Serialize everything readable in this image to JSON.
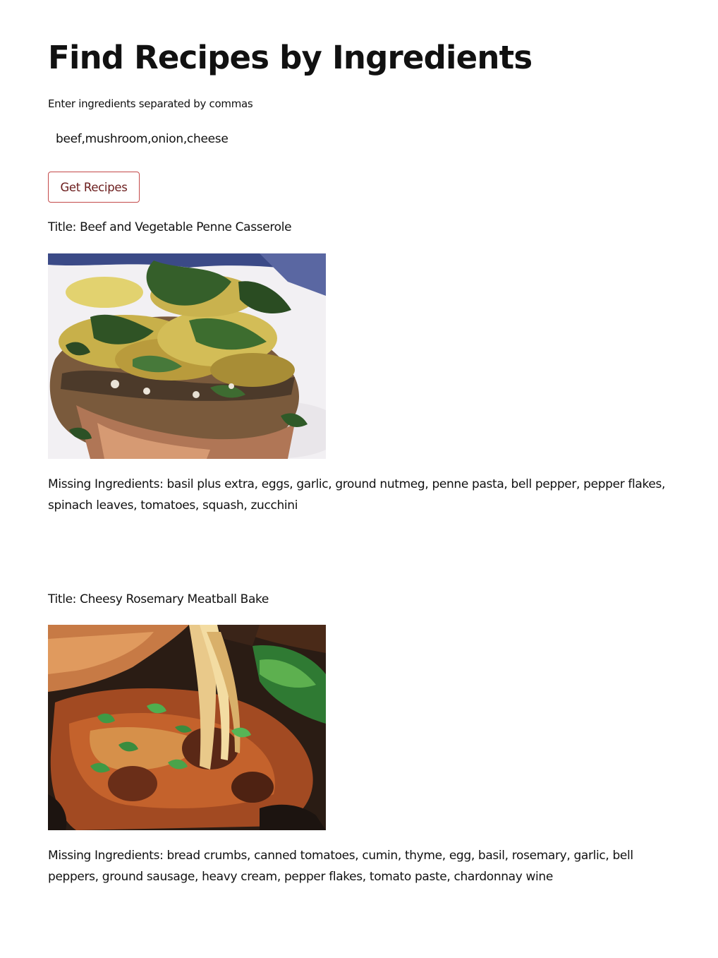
{
  "page": {
    "title": "Find Recipes by Ingredients"
  },
  "search": {
    "label": "Enter ingredients separated by commas",
    "value": "beef,mushroom,onion,cheese",
    "button_label": "Get Recipes"
  },
  "labels": {
    "title_prefix": "Title:",
    "missing_prefix": "Missing Ingredients:"
  },
  "recipes": [
    {
      "title": "Beef and Vegetable Penne Casserole",
      "image": "recipe-photo-beef-vegetable-penne-casserole",
      "missing": "basil plus extra, eggs, garlic, ground nutmeg, penne pasta, bell pepper, pepper flakes, spinach leaves, tomatoes, squash, zucchini"
    },
    {
      "title": "Cheesy Rosemary Meatball Bake",
      "image": "recipe-photo-cheesy-rosemary-meatball-bake",
      "missing": "bread crumbs, canned tomatoes, cumin, thyme, egg, basil, rosemary, garlic, bell peppers, ground sausage, heavy cream, pepper flakes, tomato paste, chardonnay wine"
    }
  ],
  "colors": {
    "button_border": "#c44a4a",
    "button_text": "#6b1d1d",
    "text": "#111111",
    "background": "#ffffff"
  }
}
